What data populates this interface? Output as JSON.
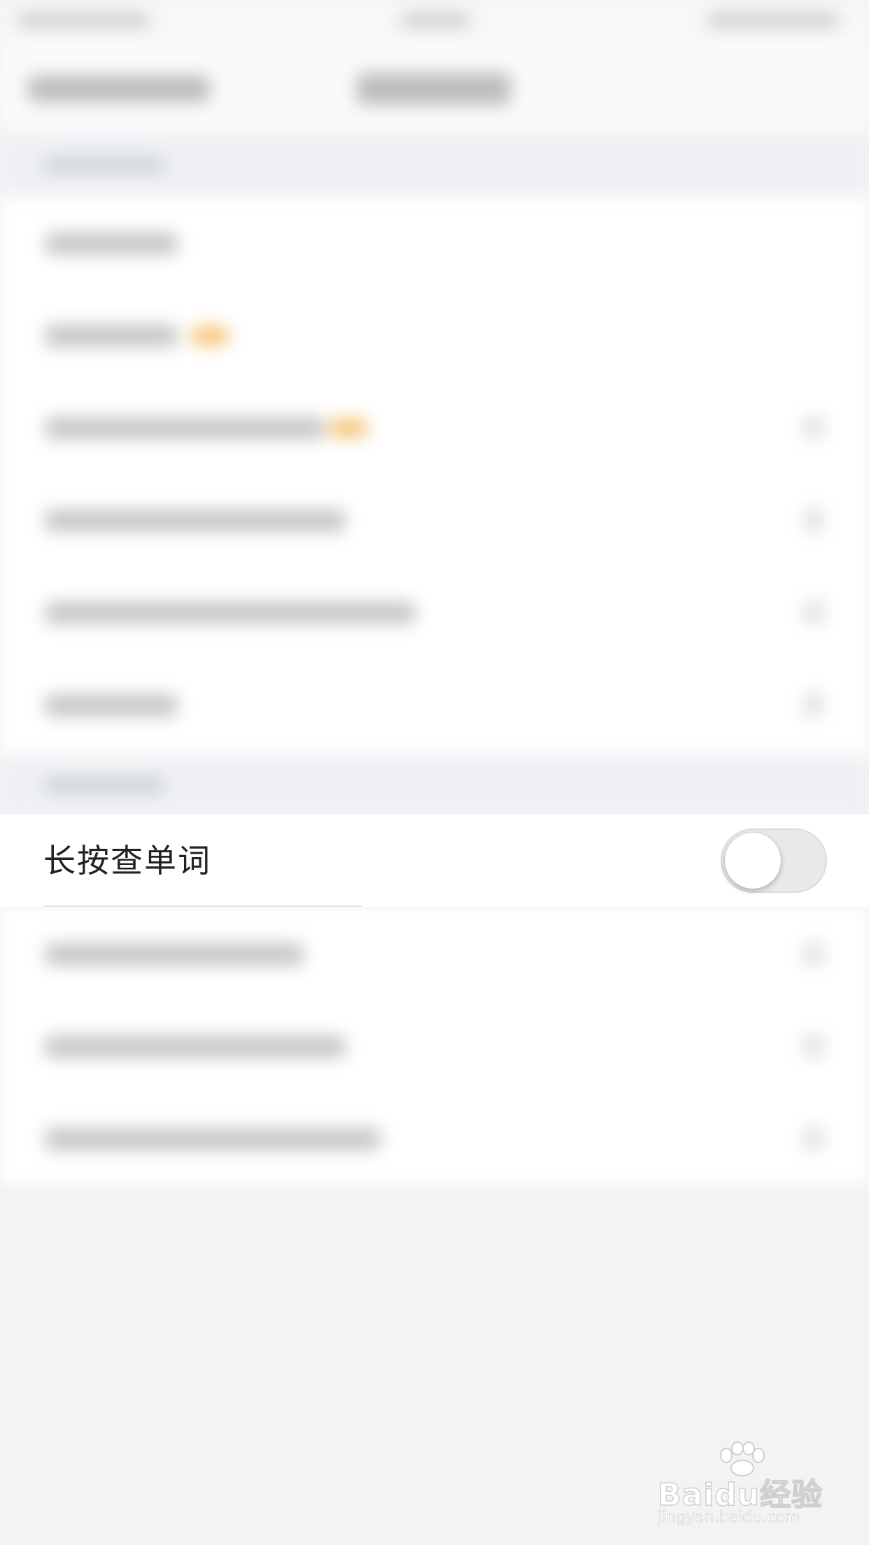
{
  "settings": {
    "long_press_lookup": {
      "label": "长按查单词",
      "enabled": false
    }
  },
  "watermark": {
    "brand": "Baidu经验",
    "url": "jingyan.baidu.com"
  },
  "colors": {
    "background": "#f2f3f5",
    "card": "#ffffff",
    "toggle_off_track": "#e9e9eb",
    "badge_accent": "#f4c77c"
  }
}
